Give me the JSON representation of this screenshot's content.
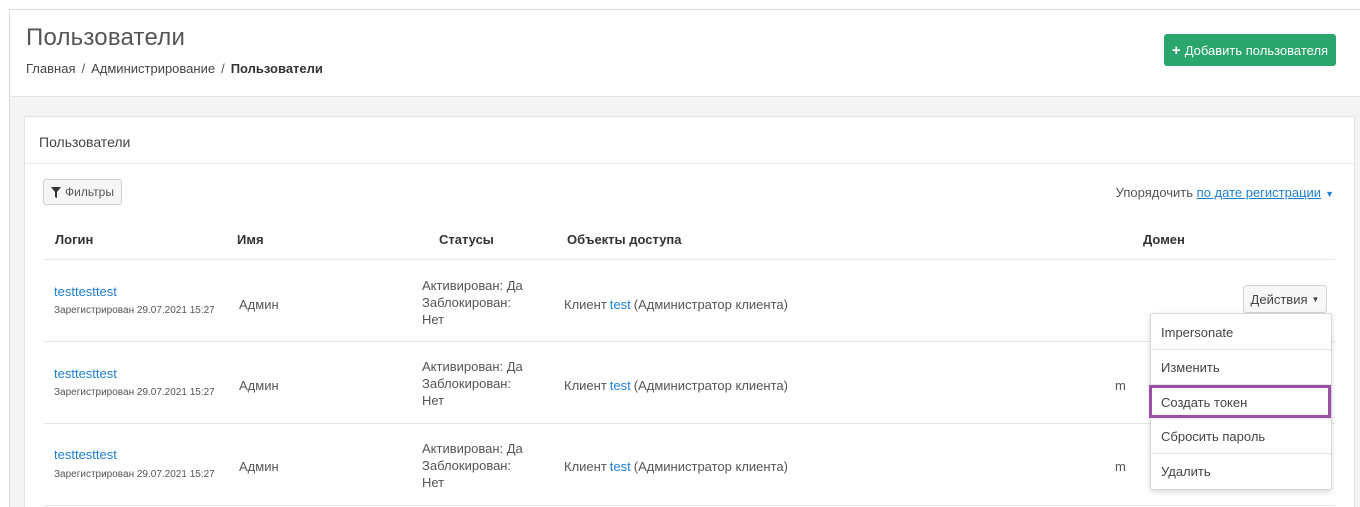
{
  "header": {
    "title": "Пользователи",
    "breadcrumb": [
      "Главная",
      "Администрирование",
      "Пользователи"
    ],
    "add_button_label": "Добавить пользователя",
    "add_button_color": "#2aa56c"
  },
  "card": {
    "title": "Пользователи",
    "filter_label": "Фильтры",
    "sort_prefix": "Упорядочить",
    "sort_value": "по дате регистрации"
  },
  "table": {
    "columns": [
      "Логин",
      "Имя",
      "Статусы",
      "Объекты доступа",
      "Домен"
    ],
    "rows": [
      {
        "login": "testtesttest",
        "registered": "Зарегистрирован 29.07.2021 15:27",
        "name": "Админ",
        "status_activated": "Активирован: Да",
        "status_blocked": "Заблокирован: Нет",
        "access_prefix": "Клиент",
        "access_link": "test",
        "access_suffix": "(Администратор клиента)",
        "domain": ""
      },
      {
        "login": "testtesttest",
        "registered": "Зарегистрирован 29.07.2021 15:27",
        "name": "Админ",
        "status_activated": "Активирован: Да",
        "status_blocked": "Заблокирован: Нет",
        "access_prefix": "Клиент",
        "access_link": "test",
        "access_suffix": "(Администратор клиента)",
        "domain": "m"
      },
      {
        "login": "testtesttest",
        "registered": "Зарегистрирован 29.07.2021 15:27",
        "name": "Админ",
        "status_activated": "Активирован: Да",
        "status_blocked": "Заблокирован: Нет",
        "access_prefix": "Клиент",
        "access_link": "test",
        "access_suffix": "(Администратор клиента)",
        "domain": "m"
      }
    ]
  },
  "actions": {
    "button_label": "Действия",
    "menu": [
      "Impersonate",
      "Изменить",
      "Создать токен",
      "Сбросить пароль",
      "Удалить"
    ],
    "highlighted_item": "Создать токен",
    "highlight_color": "#9b4fa6"
  },
  "colors": {
    "link": "#1d7fd6",
    "accent": "#2aa56c"
  }
}
